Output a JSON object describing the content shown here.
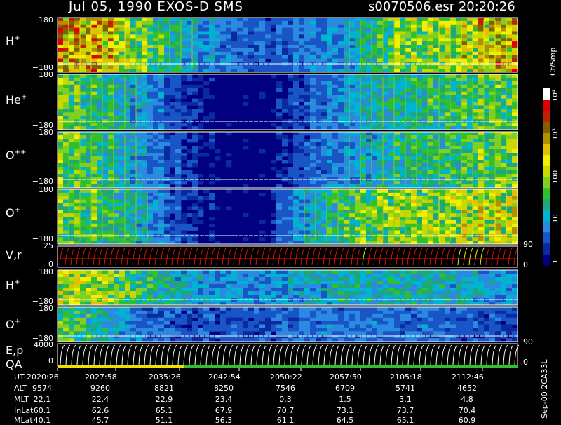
{
  "header": {
    "date_instrument": "Jul 05, 1990   EXOS-D SMS",
    "file_time": "s0070506.esr  20:20:26"
  },
  "panels": [
    {
      "label": "H",
      "charge": "+",
      "y_top": "180",
      "y_bottom": "−180"
    },
    {
      "label": "He",
      "charge": "+",
      "y_top": "180",
      "y_bottom": "−180"
    },
    {
      "label": "O",
      "charge": "++",
      "y_top": "180",
      "y_bottom": "−180"
    },
    {
      "label": "O",
      "charge": "+",
      "y_top": "180",
      "y_bottom": "−180"
    },
    {
      "label": "V,r",
      "charge": "",
      "y_top": "25",
      "y_bottom": "0",
      "right_top": "90",
      "right_bottom": "0"
    },
    {
      "label": "H",
      "charge": "+",
      "y_top": "180",
      "y_bottom": "−180"
    },
    {
      "label": "O",
      "charge": "+",
      "y_top": "180",
      "y_bottom": "−180"
    },
    {
      "label": "E,p",
      "charge": "",
      "y_top": "4000",
      "y_bottom": "0",
      "right_top": "90",
      "right_bottom": "0"
    }
  ],
  "qa_label": "QA",
  "colorbar": {
    "unit": "Ct/Smp",
    "ticks": [
      "1",
      "10",
      "100",
      "10³",
      "10⁴"
    ],
    "colors": [
      "#000080",
      "#0a2aa0",
      "#1a55c8",
      "#2a8ae0",
      "#00b4d0",
      "#1ea878",
      "#2fbf30",
      "#7fd020",
      "#c8d800",
      "#f0f000",
      "#e0c000",
      "#b09000",
      "#806000",
      "#c02000",
      "#e00000",
      "#ffffff"
    ]
  },
  "footer_vertical": "Sep-00  2CA33L",
  "ephemeris": {
    "rows": [
      {
        "name": "UT",
        "values": [
          "2020:26",
          "2027:58",
          "2035:26",
          "2042:54",
          "2050:22",
          "2057:50",
          "2105:18",
          "2112:46"
        ]
      },
      {
        "name": "ALT",
        "values": [
          "9574",
          "9260",
          "8821",
          "8250",
          "7546",
          "6709",
          "5741",
          "4652"
        ]
      },
      {
        "name": "MLT",
        "values": [
          "22.1",
          "22.4",
          "22.9",
          "23.4",
          "0.3",
          "1.5",
          "3.1",
          "4.8"
        ]
      },
      {
        "name": "InLat",
        "values": [
          "60.1",
          "62.6",
          "65.1",
          "67.9",
          "70.7",
          "73.1",
          "73.7",
          "70.4"
        ]
      },
      {
        "name": "MLat",
        "values": [
          "40.1",
          "45.7",
          "51.1",
          "56.3",
          "61.1",
          "64.5",
          "65.1",
          "60.9"
        ]
      }
    ]
  },
  "chart_data": {
    "type": "heatmap",
    "title": "Jul 05, 1990   EXOS-D SMS",
    "x_ticks": [
      "2020:26",
      "2027:58",
      "2035:26",
      "2042:54",
      "2050:22",
      "2057:50",
      "2105:18",
      "2112:46"
    ],
    "colorbar_unit": "Ct/Smp",
    "colorbar_range": [
      1,
      10000
    ],
    "colorbar_scale": "log",
    "series": [
      {
        "name": "H+",
        "ylim": [
          -180,
          180
        ],
        "intensity_profile": [
          0.9,
          0.85,
          0.55,
          0.35,
          0.25,
          0.2,
          0.25,
          0.3,
          0.55,
          0.6,
          0.7,
          0.85
        ]
      },
      {
        "name": "He+",
        "ylim": [
          -180,
          180
        ],
        "intensity_profile": [
          0.55,
          0.45,
          0.3,
          0.15,
          0.1,
          0.1,
          0.2,
          0.3,
          0.4,
          0.45,
          0.5,
          0.55
        ]
      },
      {
        "name": "O++",
        "ylim": [
          -180,
          180
        ],
        "intensity_profile": [
          0.55,
          0.45,
          0.3,
          0.15,
          0.1,
          0.1,
          0.2,
          0.3,
          0.4,
          0.45,
          0.5,
          0.55
        ]
      },
      {
        "name": "O+",
        "ylim": [
          -180,
          180
        ],
        "intensity_profile": [
          0.55,
          0.5,
          0.35,
          0.15,
          0.1,
          0.1,
          0.35,
          0.5,
          0.6,
          0.6,
          0.65,
          0.7
        ]
      },
      {
        "name": "V,r",
        "ylim": [
          0,
          25
        ]
      },
      {
        "name": "H+",
        "ylim": [
          -180,
          180
        ],
        "intensity_profile": [
          0.7,
          0.65,
          0.5,
          0.35,
          0.3,
          0.3,
          0.35,
          0.4,
          0.4,
          0.4,
          0.35,
          0.3
        ]
      },
      {
        "name": "O+",
        "ylim": [
          -180,
          180
        ],
        "intensity_profile": [
          0.55,
          0.4,
          0.25,
          0.2,
          0.2,
          0.2,
          0.25,
          0.25,
          0.25,
          0.25,
          0.2,
          0.2
        ]
      },
      {
        "name": "E,p",
        "ylim": [
          0,
          4000
        ]
      }
    ]
  }
}
